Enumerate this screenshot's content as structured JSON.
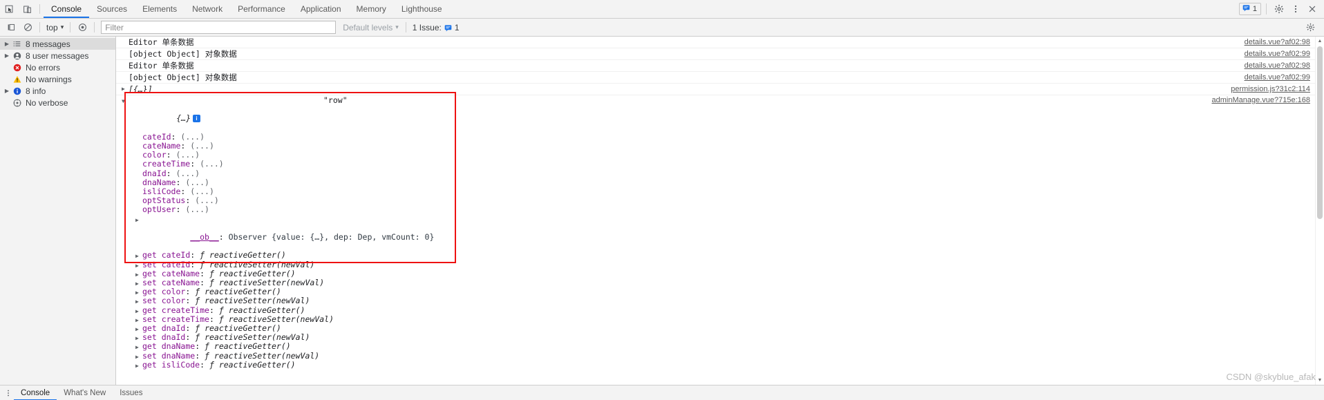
{
  "window": {
    "title": "Chrome DevTools Console"
  },
  "tabbar": {
    "inspect_icon": "inspect-element-icon",
    "device_icon": "device-toolbar-icon",
    "tabs": [
      {
        "label": "Console",
        "active": true
      },
      {
        "label": "Sources",
        "active": false
      },
      {
        "label": "Elements",
        "active": false
      },
      {
        "label": "Network",
        "active": false
      },
      {
        "label": "Performance",
        "active": false
      },
      {
        "label": "Application",
        "active": false
      },
      {
        "label": "Memory",
        "active": false
      },
      {
        "label": "Lighthouse",
        "active": false
      }
    ],
    "issue_count": "1",
    "issue_icon": "issue-message-icon",
    "settings_icon": "gear-icon",
    "more_icon": "kebab-menu-icon",
    "close_icon": "close-icon"
  },
  "filterbar": {
    "clear_icon": "clear-console-icon",
    "noentry_icon": "no-entry-icon",
    "context": "top",
    "context_caret": "▾",
    "eye_icon": "live-expression-icon",
    "filter_placeholder": "Filter",
    "filter_value": "",
    "levels_label": "Default levels",
    "levels_caret": "▾",
    "issues_label": "1 Issue:",
    "issues_count": "1",
    "settings_icon": "console-settings-icon"
  },
  "sidebar": {
    "items": [
      {
        "label": "8 messages",
        "icon": "list-icon",
        "arrow": true,
        "selected": true
      },
      {
        "label": "8 user messages",
        "icon": "user-icon",
        "arrow": true,
        "selected": false
      },
      {
        "label": "No errors",
        "icon": "error-icon",
        "arrow": false,
        "selected": false
      },
      {
        "label": "No warnings",
        "icon": "warning-icon",
        "arrow": false,
        "selected": false
      },
      {
        "label": "8 info",
        "icon": "info-icon",
        "arrow": true,
        "selected": false
      },
      {
        "label": "No verbose",
        "icon": "verbose-icon",
        "arrow": false,
        "selected": false
      }
    ]
  },
  "console": {
    "messages": [
      {
        "text": "Editor 单条数据",
        "source": "details.vue?af02:98"
      },
      {
        "text": "[object Object] 对象数据",
        "source": "details.vue?af02:99"
      },
      {
        "text": "Editor 单条数据",
        "source": "details.vue?af02:98"
      },
      {
        "text": "[object Object] 对象数据",
        "source": "details.vue?af02:99"
      },
      {
        "text": "[{…}]",
        "source": "permission.js?31c2:114",
        "collapsed_array": true
      },
      {
        "text": "{…}",
        "source": "adminManage.vue?715e:168",
        "expanded_object": true,
        "row_tag": "\"row\""
      }
    ],
    "expanded": {
      "header": "{…}",
      "header_badge": "i",
      "row_tag": "\"row\"",
      "properties": [
        {
          "name": "cateId",
          "value": "(...)"
        },
        {
          "name": "cateName",
          "value": "(...)"
        },
        {
          "name": "color",
          "value": "(...)"
        },
        {
          "name": "createTime",
          "value": "(...)"
        },
        {
          "name": "dnaId",
          "value": "(...)"
        },
        {
          "name": "dnaName",
          "value": "(...)"
        },
        {
          "name": "isliCode",
          "value": "(...)"
        },
        {
          "name": "optStatus",
          "value": "(...)"
        },
        {
          "name": "optUser",
          "value": "(...)"
        }
      ],
      "observer": {
        "key": "__ob__",
        "value": "Observer {value: {…}, dep: Dep, vmCount: 0}"
      },
      "accessors": [
        {
          "kind": "get",
          "name": "cateId",
          "fn": "reactiveGetter()"
        },
        {
          "kind": "set",
          "name": "cateId",
          "fn": "reactiveSetter(newVal)"
        },
        {
          "kind": "get",
          "name": "cateName",
          "fn": "reactiveGetter()"
        },
        {
          "kind": "set",
          "name": "cateName",
          "fn": "reactiveSetter(newVal)"
        },
        {
          "kind": "get",
          "name": "color",
          "fn": "reactiveGetter()"
        },
        {
          "kind": "set",
          "name": "color",
          "fn": "reactiveSetter(newVal)"
        },
        {
          "kind": "get",
          "name": "createTime",
          "fn": "reactiveGetter()"
        },
        {
          "kind": "set",
          "name": "createTime",
          "fn": "reactiveSetter(newVal)"
        },
        {
          "kind": "get",
          "name": "dnaId",
          "fn": "reactiveGetter()"
        },
        {
          "kind": "set",
          "name": "dnaId",
          "fn": "reactiveSetter(newVal)"
        },
        {
          "kind": "get",
          "name": "dnaName",
          "fn": "reactiveGetter()"
        },
        {
          "kind": "set",
          "name": "dnaName",
          "fn": "reactiveSetter(newVal)"
        },
        {
          "kind": "get",
          "name": "isliCode",
          "fn": "reactiveGetter()"
        }
      ]
    }
  },
  "drawer": {
    "kebab_icon": "kebab-menu-icon",
    "tabs": [
      {
        "label": "Console",
        "active": true
      },
      {
        "label": "What's New",
        "active": false
      },
      {
        "label": "Issues",
        "active": false
      }
    ]
  },
  "watermark": "CSDN @skyblue_afak",
  "colors": {
    "accent": "#1a73e8",
    "propname": "#881391",
    "error": "#d93025",
    "warning": "#f9ab00",
    "highlight_box": "#ee1111",
    "toolbar_bg": "#f3f3f3"
  }
}
